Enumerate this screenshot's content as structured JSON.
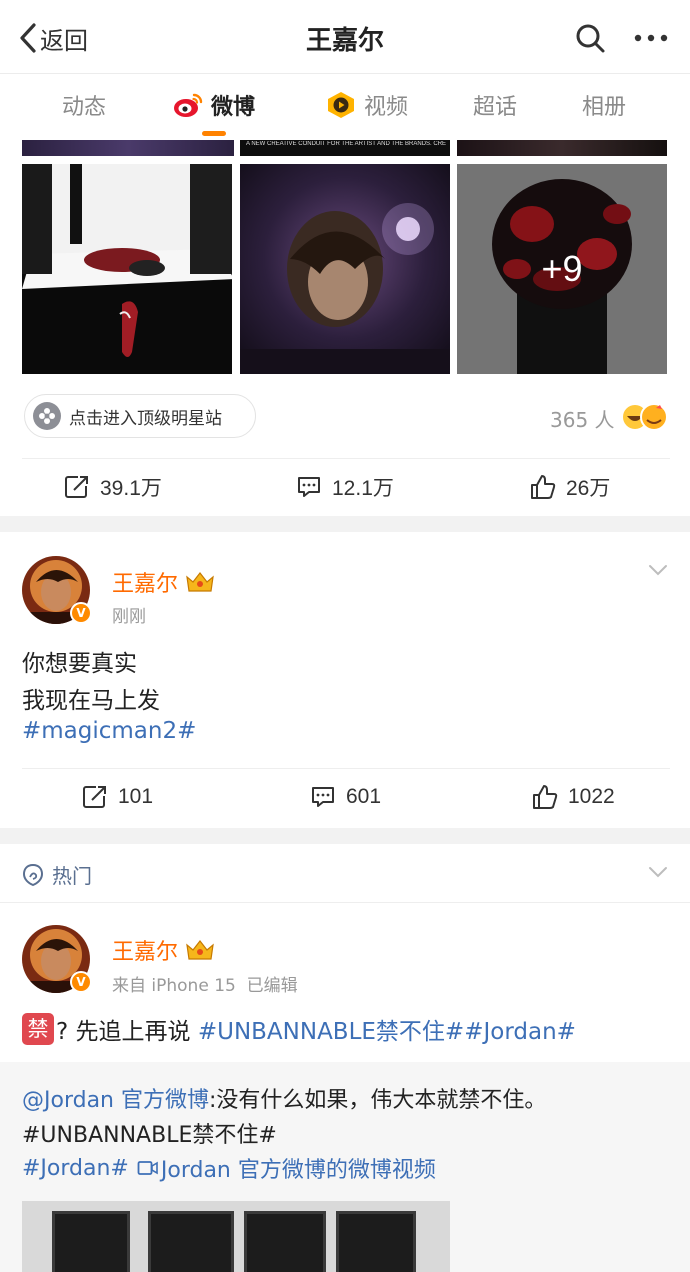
{
  "nav": {
    "back_label": "返回",
    "title": "王嘉尔",
    "search_icon": "search-icon",
    "more_icon": "more-icon"
  },
  "tabs": [
    {
      "label": "动态",
      "active": false
    },
    {
      "label": "微博",
      "active": true,
      "icon": "weibo-icon"
    },
    {
      "label": "视频",
      "active": false,
      "icon": "video-tab-icon"
    },
    {
      "label": "超话",
      "active": false
    },
    {
      "label": "相册",
      "active": false
    }
  ],
  "first_post": {
    "banner_text": "A NEW CREATIVE CONDUIT FOR THE ARTIST AND THE BRANDS. CREATIVE DIRECTOR",
    "more_images": "+9",
    "star_site_label": "点击进入顶级明星站",
    "reaction_count": "365 人",
    "actions": {
      "repost": "39.1万",
      "comment": "12.1万",
      "like": "26万"
    }
  },
  "second_post": {
    "author": "王嘉尔",
    "time": "刚刚",
    "lines": [
      "你想要真实",
      "我现在马上发"
    ],
    "hashtag": "#magicman2#",
    "actions": {
      "repost": "101",
      "comment": "601",
      "like": "1022"
    }
  },
  "hot_section": {
    "label": "热门"
  },
  "third_post": {
    "author": "王嘉尔",
    "source": "来自 iPhone 15",
    "edited": "已编辑",
    "ban_badge": "禁",
    "text_prefix": "? 先追上再说 ",
    "hashtags": "#UNBANNABLE禁不住##Jordan#",
    "quote": {
      "mention": "@Jordan 官方微博",
      "text": ":没有什么如果，伟大本就禁不住。",
      "tag1": "#UNBANNABLE禁不住#",
      "tag2": "#Jordan#",
      "video_link": "Jordan 官方微博的微博视频"
    }
  },
  "colors": {
    "accent": "#ff8200",
    "author": "#ff6a00",
    "link": "#3d6fb6",
    "muted": "#999999",
    "separator": "#f2f2f2"
  }
}
